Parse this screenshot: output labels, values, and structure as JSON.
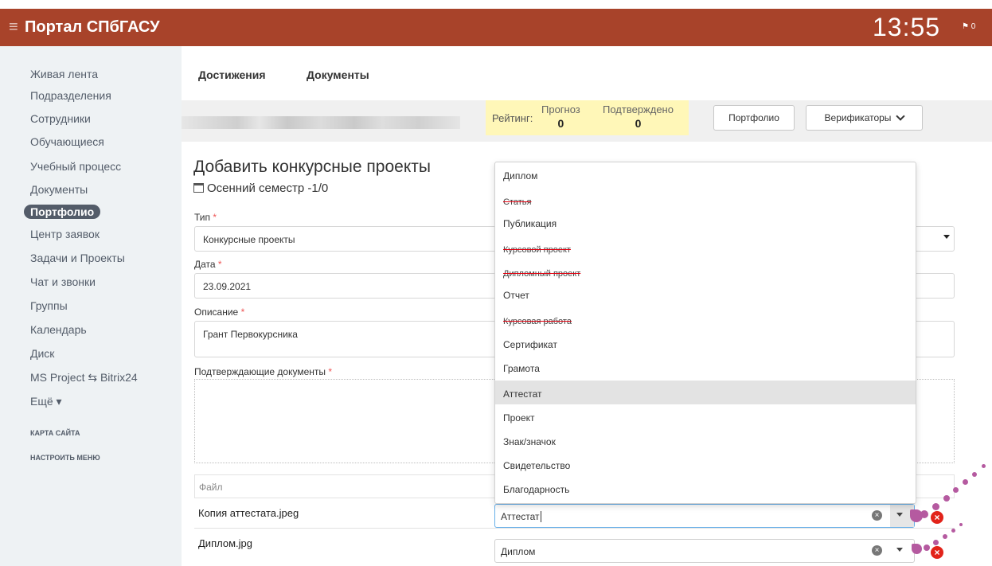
{
  "header": {
    "title": "Портал СПбГАСУ",
    "clock": "13:55",
    "notifications": "0"
  },
  "sidebar": {
    "items": [
      "Живая лента",
      "Подразделения",
      "Сотрудники",
      "Обучающиеся",
      "Учебный процесс",
      "Документы",
      "Портфолио",
      "Центр заявок",
      "Задачи и Проекты",
      "Чат и звонки",
      "Группы",
      "Календарь",
      "Диск",
      "MS Project ⇆ Bitrix24",
      "Ещё ▾"
    ],
    "active": "Портфолио",
    "sitemap": "КАРТА САЙТА",
    "configure": "НАСТРОИТЬ МЕНЮ"
  },
  "tabs": [
    "Достижения",
    "Документы"
  ],
  "rating": {
    "label": "Рейтинг:",
    "forecast_label": "Прогноз",
    "forecast_value": "0",
    "confirmed_label": "Подтверждено",
    "confirmed_value": "0"
  },
  "buttons": {
    "portfolio": "Портфолио",
    "verifiers": "Верификаторы"
  },
  "form": {
    "title": "Добавить конкурсные проекты",
    "semester": "Осенний семестр -1/0",
    "type_label": "Тип",
    "type_value": "Конкурсные проекты",
    "date_label": "Дата",
    "date_value": "23.09.2021",
    "description_label": "Описание",
    "description_value": "Грант Первокурсника",
    "docs_label": "Подтверждающие документы",
    "required_mark": "*"
  },
  "files": {
    "header": "Файл",
    "rows": [
      {
        "name": "Копия аттестата.jpeg",
        "doc_type": "Аттестат"
      },
      {
        "name": "Диплом.jpg",
        "doc_type": "Диплом"
      }
    ]
  },
  "dropdown": {
    "options": [
      {
        "label": "Диплом",
        "struck": false
      },
      {
        "label": "Статья",
        "struck": true
      },
      {
        "label": "Публикация",
        "struck": false
      },
      {
        "label": "Курсовой проект",
        "struck": true
      },
      {
        "label": "Дипломный проект",
        "struck": true
      },
      {
        "label": "Отчет",
        "struck": false
      },
      {
        "label": "Курсовая работа",
        "struck": true
      },
      {
        "label": "Сертификат",
        "struck": false
      },
      {
        "label": "Грамота",
        "struck": false
      },
      {
        "label": "Аттестат",
        "struck": false
      },
      {
        "label": "Проект",
        "struck": false
      },
      {
        "label": "Знак/значок",
        "struck": false
      },
      {
        "label": "Свидетельство",
        "struck": false
      },
      {
        "label": "Благодарность",
        "struck": false
      }
    ],
    "highlighted": "Аттестат"
  },
  "colors": {
    "header_bg": "#a8432a",
    "sidebar_bg": "#eef2f4",
    "rating_bg": "#fff7b8",
    "strike": "#e3000f",
    "remove": "#e2231a",
    "annotation": "#b55aa0"
  }
}
